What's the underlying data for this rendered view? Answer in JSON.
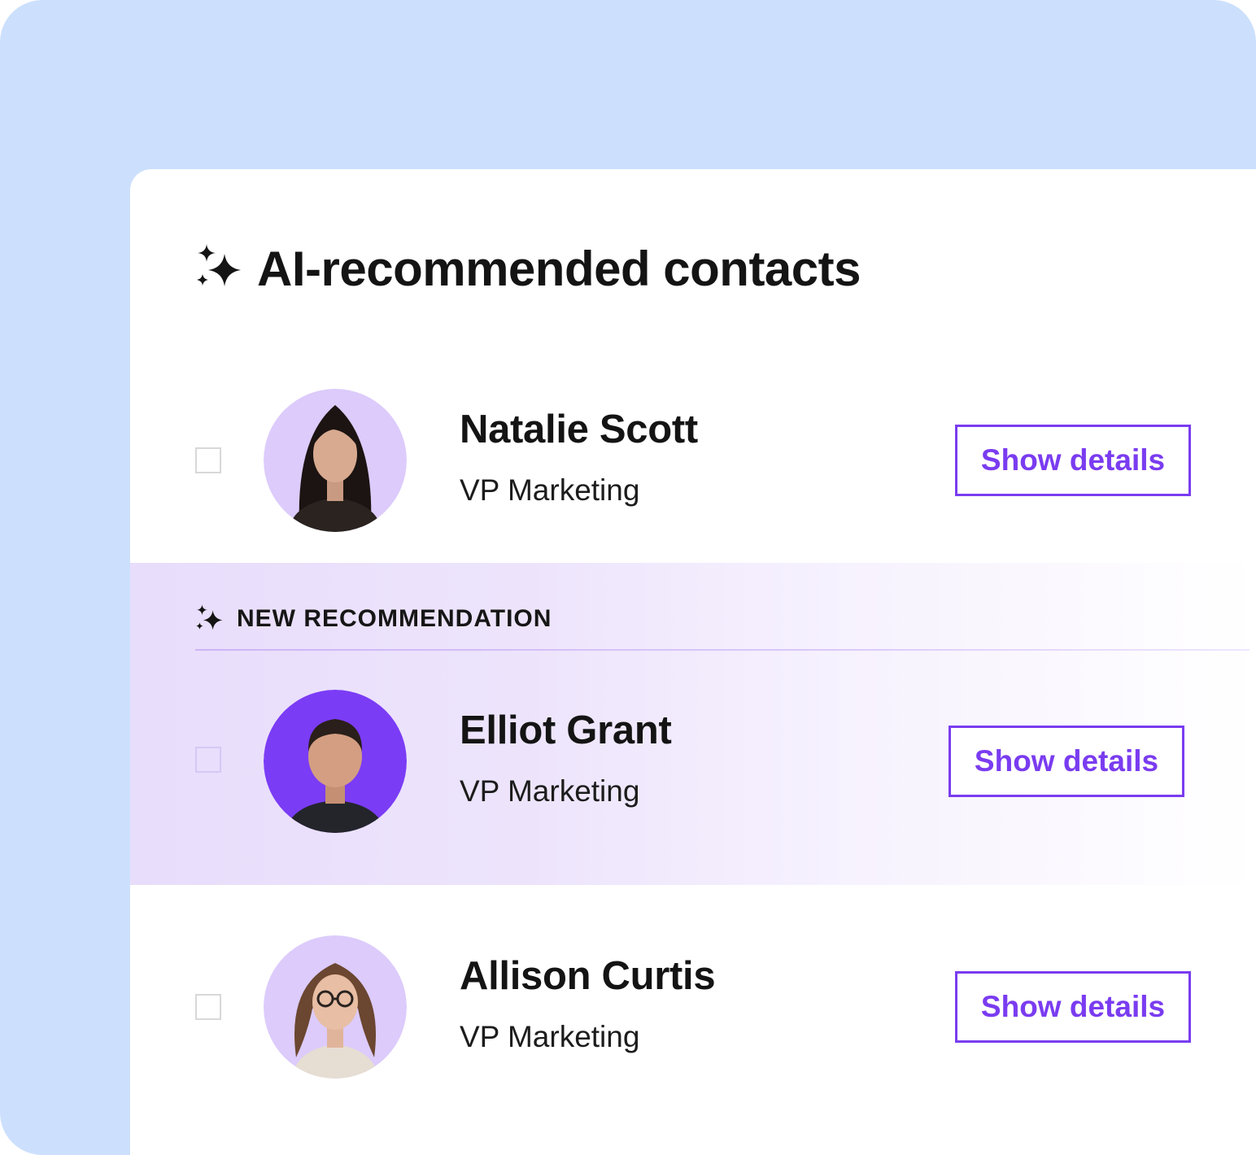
{
  "panel": {
    "title": "AI-recommended contacts",
    "title_icon": "sparkle-icon"
  },
  "recommendation_banner": {
    "label": "NEW RECOMMENDATION",
    "icon": "sparkle-icon"
  },
  "contacts": [
    {
      "name": "Natalie Scott",
      "role": "VP Marketing",
      "button_label": "Show details",
      "checked": false,
      "avatar_bg": "#dccbfb"
    },
    {
      "name": "Elliot Grant",
      "role": "VP Marketing",
      "button_label": "Show details",
      "checked": false,
      "avatar_bg": "#7b3cf5",
      "new_recommendation": true
    },
    {
      "name": "Allison Curtis",
      "role": "VP Marketing",
      "button_label": "Show details",
      "checked": false,
      "avatar_bg": "#dccbfb"
    }
  ],
  "colors": {
    "background": "#cce0fd",
    "accent": "#7a3cf0",
    "highlight": "#e8ddfb"
  }
}
